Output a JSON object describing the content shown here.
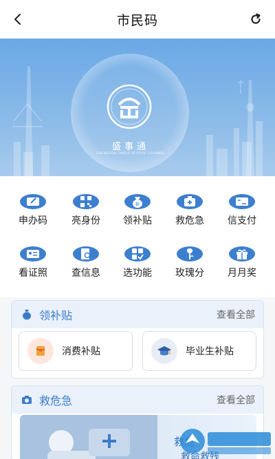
{
  "header": {
    "title": "市民码"
  },
  "banner": {
    "brand": "盛事通",
    "brand_sub": "SHENZHEN FAMILY AFFAIRS CHANNEL"
  },
  "grid": [
    {
      "label": "申办码",
      "icon": "card-edit-icon"
    },
    {
      "label": "亮身份",
      "icon": "qr-code-icon"
    },
    {
      "label": "领补贴",
      "icon": "subsidy-bag-icon"
    },
    {
      "label": "救危急",
      "icon": "first-aid-icon"
    },
    {
      "label": "信支付",
      "icon": "credit-card-icon"
    },
    {
      "label": "看证照",
      "icon": "id-card-icon"
    },
    {
      "label": "查信息",
      "icon": "search-document-icon"
    },
    {
      "label": "选功能",
      "icon": "apps-grid-icon"
    },
    {
      "label": "玫瑰分",
      "icon": "rose-icon"
    },
    {
      "label": "月月奖",
      "icon": "gift-icon"
    }
  ],
  "subsidy": {
    "title": "领补贴",
    "more": "查看全部",
    "items": [
      {
        "label": "消费补贴",
        "icon": "red-envelope-icon"
      },
      {
        "label": "毕业生补贴",
        "icon": "graduation-cap-icon"
      }
    ]
  },
  "emergency": {
    "title": "救危急",
    "more": "查看全部",
    "promo_title": "救危",
    "promo_sub": "救命救残"
  },
  "colors": {
    "primary": "#3d7fcf",
    "accent_text": "#3b7cc9"
  }
}
